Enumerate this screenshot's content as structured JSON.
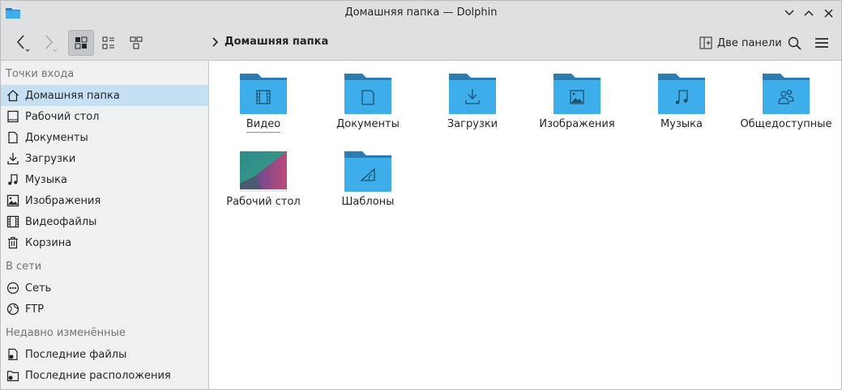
{
  "window": {
    "title": "Домашняя папка — Dolphin"
  },
  "toolbar": {
    "breadcrumb_current": "Домашняя папка",
    "split_label": "Две панели"
  },
  "sidebar": {
    "sections": [
      {
        "label": "Точки входа"
      },
      {
        "label": "В сети"
      },
      {
        "label": "Недавно изменённые"
      }
    ],
    "places": [
      {
        "label": "Домашняя папка",
        "icon": "home-icon",
        "selected": true
      },
      {
        "label": "Рабочий стол",
        "icon": "desktop-icon"
      },
      {
        "label": "Документы",
        "icon": "document-icon"
      },
      {
        "label": "Загрузки",
        "icon": "download-icon"
      },
      {
        "label": "Музыка",
        "icon": "music-icon"
      },
      {
        "label": "Изображения",
        "icon": "image-icon"
      },
      {
        "label": "Видеофайлы",
        "icon": "video-icon"
      },
      {
        "label": "Корзина",
        "icon": "trash-icon"
      }
    ],
    "network": [
      {
        "label": "Сеть",
        "icon": "network-icon"
      },
      {
        "label": "FTP",
        "icon": "globe-icon"
      }
    ],
    "recent": [
      {
        "label": "Последние файлы",
        "icon": "recent-files-icon"
      },
      {
        "label": "Последние расположения",
        "icon": "recent-locations-icon"
      }
    ]
  },
  "main": {
    "items": [
      {
        "label": "Видео",
        "icon": "folder-video-icon"
      },
      {
        "label": "Документы",
        "icon": "folder-documents-icon"
      },
      {
        "label": "Загрузки",
        "icon": "folder-downloads-icon"
      },
      {
        "label": "Изображения",
        "icon": "folder-pictures-icon"
      },
      {
        "label": "Музыка",
        "icon": "folder-music-icon"
      },
      {
        "label": "Общедоступные",
        "icon": "folder-public-icon"
      },
      {
        "label": "Рабочий стол",
        "icon": "desktop-thumbnail"
      },
      {
        "label": "Шаблоны",
        "icon": "folder-templates-icon"
      }
    ]
  },
  "colors": {
    "folder_body": "#3daee9",
    "folder_tab": "#2a7cb1",
    "selection": "#c6e0f3",
    "accent": "#3daee9"
  }
}
